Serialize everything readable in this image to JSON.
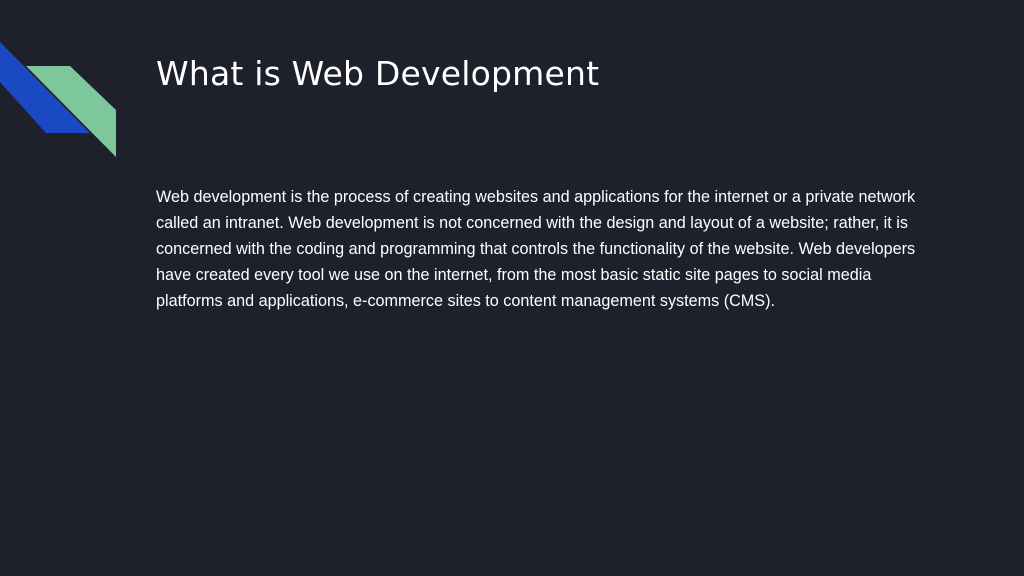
{
  "slide": {
    "title": "What is Web Development",
    "body": "Web development is the process of creating websites and applications for the internet or a private network called an intranet. Web development is not concerned with the design and layout of a website; rather, it is concerned with the coding and programming that controls the functionality of the website. Web developers have created every tool we use on the internet, from the most basic static site pages to social media platforms and applications, e-commerce sites to content management systems (CMS)."
  },
  "colors": {
    "background": "#1e212c",
    "accent_blue": "#1b49c4",
    "accent_green": "#7dc79a",
    "text": "#ffffff"
  }
}
